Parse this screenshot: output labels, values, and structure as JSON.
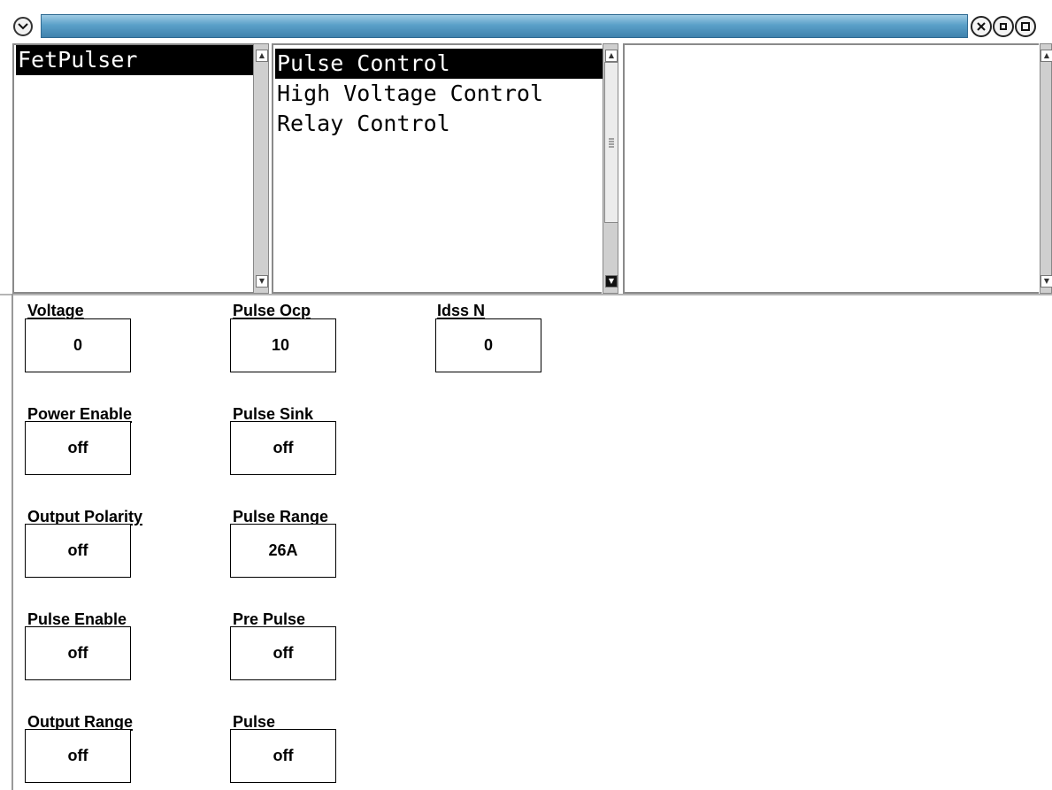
{
  "window": {
    "menu_icon": "chevron-down-icon",
    "buttons": {
      "close_icon": "close-icon",
      "minimize_icon": "minimize-icon",
      "maximize_icon": "maximize-icon"
    },
    "titlebar_color": "#5aa0c8"
  },
  "pane1": {
    "items": [
      {
        "label": "FetPulser",
        "selected": true
      }
    ]
  },
  "pane2": {
    "items": [
      {
        "label": "Pulse Control",
        "selected": true
      },
      {
        "label": "High Voltage Control",
        "selected": false
      },
      {
        "label": "Relay Control",
        "selected": false
      }
    ]
  },
  "pane3": {
    "items": []
  },
  "fields": {
    "voltage": {
      "label": "Voltage",
      "value": "0"
    },
    "pulse_ocp": {
      "label": "Pulse Ocp",
      "value": "10"
    },
    "idss_n": {
      "label": "Idss N",
      "value": "0"
    },
    "power_enable": {
      "label": "Power Enable",
      "value": "off"
    },
    "pulse_sink": {
      "label": "Pulse Sink",
      "value": "off"
    },
    "output_polarity": {
      "label": "Output Polarity",
      "value": "off"
    },
    "pulse_range": {
      "label": "Pulse Range",
      "value": "26A"
    },
    "pulse_enable": {
      "label": "Pulse Enable",
      "value": "off"
    },
    "pre_pulse": {
      "label": "Pre Pulse",
      "value": "off"
    },
    "output_range": {
      "label": "Output Range",
      "value": "off"
    },
    "pulse": {
      "label": "Pulse",
      "value": "off"
    }
  }
}
